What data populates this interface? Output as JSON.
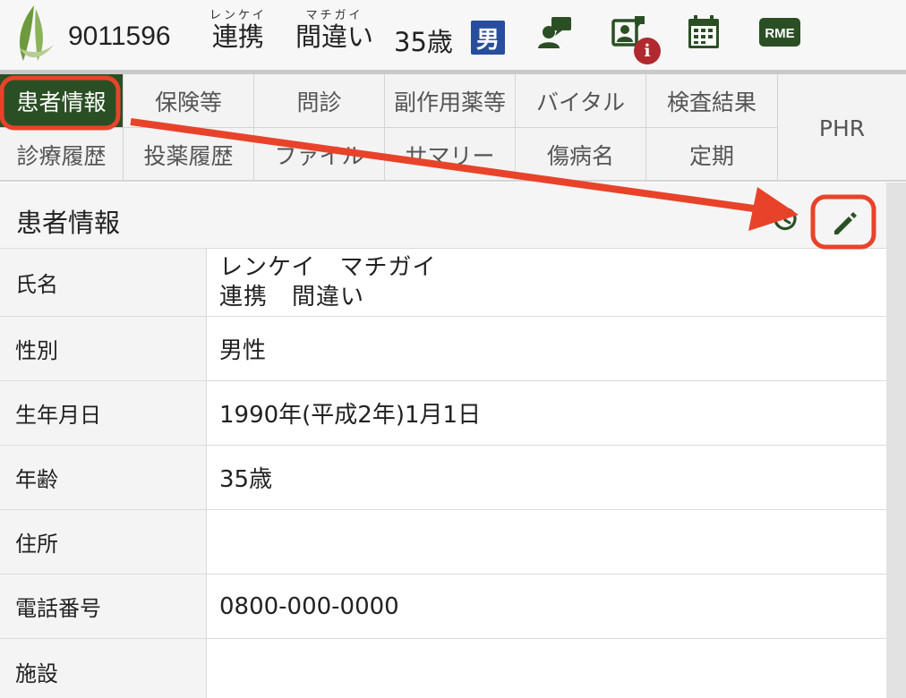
{
  "header": {
    "patient_id": "9011596",
    "last_name_kana": "レンケイ",
    "last_name": "連携",
    "first_name_kana": "マチガイ",
    "first_name": "間違い",
    "age": "35歳",
    "sex_badge": "男",
    "rme_label": "RME",
    "info_badge": "i",
    "icons": [
      "leaf-logo-icon",
      "chat-user-icon",
      "user-card-icon",
      "calendar-icon",
      "rme-icon"
    ],
    "colors": {
      "brand_green": "#2b4f24",
      "sex_blue": "#274d9c",
      "alert_red": "#b0292e"
    }
  },
  "tabs": {
    "row1": [
      "患者情報",
      "保険等",
      "問診",
      "副作用薬等",
      "バイタル",
      "検査結果"
    ],
    "row2": [
      "診療履歴",
      "投薬履歴",
      "ファイル",
      "サマリー",
      "傷病名",
      "定期"
    ],
    "phr": "PHR",
    "active": "患者情報"
  },
  "panel": {
    "title": "患者情報",
    "actions": [
      "history-icon",
      "edit-icon"
    ],
    "rows": [
      {
        "label": "氏名",
        "value_line1": "レンケイ　マチガイ",
        "value_line2": "連携　間違い"
      },
      {
        "label": "性別",
        "value": "男性"
      },
      {
        "label": "生年月日",
        "value": "1990年(平成2年)1月1日"
      },
      {
        "label": "年齢",
        "value": "35歳"
      },
      {
        "label": "住所",
        "value": ""
      },
      {
        "label": "電話番号",
        "value": "0800-000-0000"
      },
      {
        "label": "施設",
        "value": ""
      }
    ]
  },
  "annotation": {
    "color": "#e8432a",
    "icons": [
      "arrow-annotation",
      "highlight-box"
    ]
  }
}
